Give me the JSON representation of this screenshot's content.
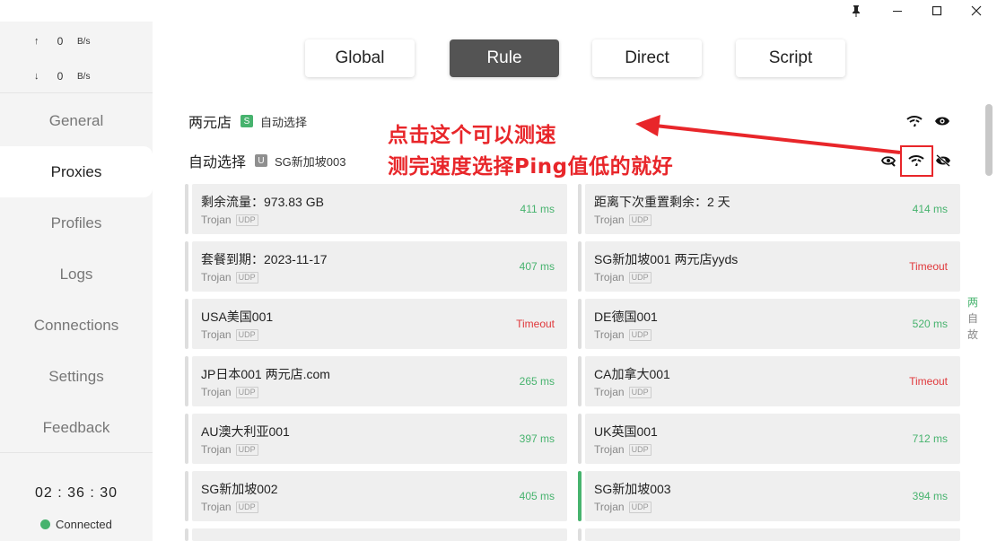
{
  "titlebar": {
    "pin": "📌",
    "minimize": "─",
    "maximize": "☐",
    "close": "✕"
  },
  "traffic": {
    "up_arrow": "↑",
    "up_value": "0",
    "up_unit": "B/s",
    "down_arrow": "↓",
    "down_value": "0",
    "down_unit": "B/s"
  },
  "nav": {
    "items": [
      "General",
      "Proxies",
      "Profiles",
      "Logs",
      "Connections",
      "Settings",
      "Feedback"
    ]
  },
  "status": {
    "clock": "02 : 36 : 30",
    "connection": "Connected"
  },
  "modes": [
    "Global",
    "Rule",
    "Direct",
    "Script"
  ],
  "groups": [
    {
      "name": "两元店",
      "badge": "S",
      "selected": "自动选择"
    },
    {
      "name": "自动选择",
      "badge": "U",
      "selected": "SG新加坡003"
    }
  ],
  "annotation": {
    "line1": "点击这个可以测速",
    "line2": "测完速度选择Ping值低的就好"
  },
  "proxies": [
    {
      "name": "剩余流量：973.83 GB",
      "type": "Trojan",
      "udp": "UDP",
      "delay": "411 ms",
      "status": "ok"
    },
    {
      "name": "距离下次重置剩余：2 天",
      "type": "Trojan",
      "udp": "UDP",
      "delay": "414 ms",
      "status": "ok"
    },
    {
      "name": "套餐到期：2023-11-17",
      "type": "Trojan",
      "udp": "UDP",
      "delay": "407 ms",
      "status": "ok"
    },
    {
      "name": "SG新加坡001 两元店yyds",
      "type": "Trojan",
      "udp": "UDP",
      "delay": "Timeout",
      "status": "timeout"
    },
    {
      "name": "USA美国001",
      "type": "Trojan",
      "udp": "UDP",
      "delay": "Timeout",
      "status": "timeout"
    },
    {
      "name": "DE德国001",
      "type": "Trojan",
      "udp": "UDP",
      "delay": "520 ms",
      "status": "ok"
    },
    {
      "name": "JP日本001 两元店.com",
      "type": "Trojan",
      "udp": "UDP",
      "delay": "265 ms",
      "status": "ok"
    },
    {
      "name": "CA加拿大001",
      "type": "Trojan",
      "udp": "UDP",
      "delay": "Timeout",
      "status": "timeout"
    },
    {
      "name": "AU澳大利亚001",
      "type": "Trojan",
      "udp": "UDP",
      "delay": "397 ms",
      "status": "ok"
    },
    {
      "name": "UK英国001",
      "type": "Trojan",
      "udp": "UDP",
      "delay": "712 ms",
      "status": "ok"
    },
    {
      "name": "SG新加坡002",
      "type": "Trojan",
      "udp": "UDP",
      "delay": "405 ms",
      "status": "ok"
    },
    {
      "name": "SG新加坡003",
      "type": "Trojan",
      "udp": "UDP",
      "delay": "394 ms",
      "status": "ok",
      "selected": true
    }
  ],
  "side_letters": [
    "两",
    "自",
    "故"
  ],
  "colors": {
    "accent": "#47b36e",
    "timeout": "#e0383b",
    "annotation": "#e8262a",
    "active_mode": "#545454"
  }
}
